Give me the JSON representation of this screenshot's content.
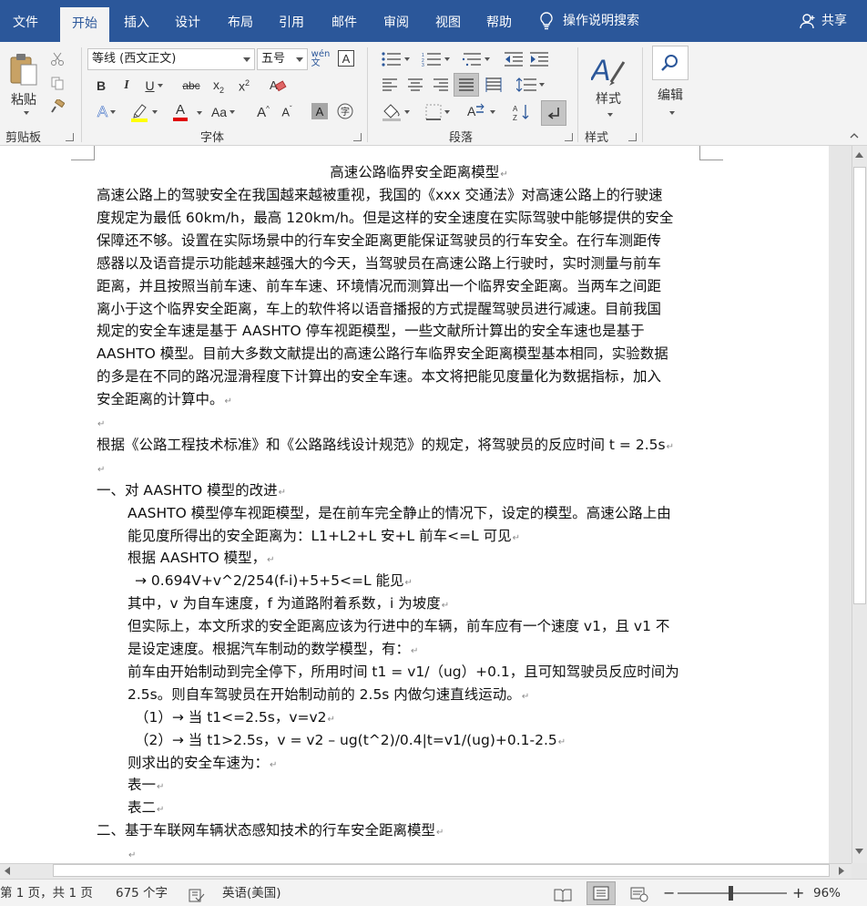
{
  "tabs": [
    "文件",
    "开始",
    "插入",
    "设计",
    "布局",
    "引用",
    "邮件",
    "审阅",
    "视图",
    "帮助"
  ],
  "tell_me": "操作说明搜索",
  "share": "共享",
  "clipboard": {
    "paste": "粘贴",
    "label": "剪贴板"
  },
  "font": {
    "name": "等线 (西文正文)",
    "size": "五号",
    "label": "字体"
  },
  "paragraph": {
    "label": "段落"
  },
  "styles": {
    "button": "样式",
    "label": "样式"
  },
  "editing": {
    "button": "编辑"
  },
  "document": {
    "title": "高速公路临界安全距离模型",
    "lines": [
      {
        "text": "高速公路上的驾驶安全在我国越来越被重视，我国的《xxx 交通法》对高速公路上的行驶速",
        "indent": 0,
        "mark": false
      },
      {
        "text": "度规定为最低 60km/h，最高 120km/h。但是这样的安全速度在实际驾驶中能够提供的安全",
        "indent": 0,
        "mark": false
      },
      {
        "text": "保障还不够。设置在实际场景中的行车安全距离更能保证驾驶员的行车安全。在行车测距传",
        "indent": 0,
        "mark": false
      },
      {
        "text": "感器以及语音提示功能越来越强大的今天，当驾驶员在高速公路上行驶时，实时测量与前车",
        "indent": 0,
        "mark": false
      },
      {
        "text": "距离，并且按照当前车速、前车车速、环境情况而测算出一个临界安全距离。当两车之间距",
        "indent": 0,
        "mark": false
      },
      {
        "text": "离小于这个临界安全距离，车上的软件将以语音播报的方式提醒驾驶员进行减速。目前我国",
        "indent": 0,
        "mark": false
      },
      {
        "text": "规定的安全车速是基于 AASHTO 停车视距模型，一些文献所计算出的安全车速也是基于",
        "indent": 0,
        "mark": false
      },
      {
        "text": "AASHTO 模型。目前大多数文献提出的高速公路行车临界安全距离模型基本相同，实验数据",
        "indent": 0,
        "mark": false
      },
      {
        "text": "的多是在不同的路况湿滑程度下计算出的安全车速。本文将把能见度量化为数据指标，加入",
        "indent": 0,
        "mark": false
      },
      {
        "text": "安全距离的计算中。",
        "indent": 0,
        "mark": true
      },
      {
        "text": "",
        "indent": 0,
        "mark": true
      },
      {
        "text": "根据《公路工程技术标准》和《公路路线设计规范》的规定，将驾驶员的反应时间 t = 2.5s",
        "indent": 0,
        "mark": true
      },
      {
        "text": "",
        "indent": 0,
        "mark": true
      },
      {
        "text": "一、对 AASHTO 模型的改进",
        "indent": 0,
        "mark": true
      },
      {
        "text": "AASHTO 模型停车视距模型，是在前车完全静止的情况下，设定的模型。高速公路上由",
        "indent": 1,
        "mark": false
      },
      {
        "text": "能见度所得出的安全距离为：L1+L2+L 安+L 前车<=L 可见",
        "indent": 1,
        "mark": true
      },
      {
        "text": "根据 AASHTO 模型，",
        "indent": 1,
        "mark": true
      },
      {
        "text": "→  0.694V+v^2/254(f-i)+5+5<=L 能见",
        "indent": 2,
        "mark": true
      },
      {
        "text": "其中，v 为自车速度，f 为道路附着系数，i 为坡度",
        "indent": 1,
        "mark": true
      },
      {
        "text": "但实际上，本文所求的安全距离应该为行进中的车辆，前车应有一个速度 v1，且 v1 不",
        "indent": 1,
        "mark": false
      },
      {
        "text": "是设定速度。根据汽车制动的数学模型，有：",
        "indent": 1,
        "mark": true
      },
      {
        "text": "前车由开始制动到完全停下，所用时间 t1 = v1/（ug）+0.1，且可知驾驶员反应时间为",
        "indent": 1,
        "mark": false
      },
      {
        "text": "2.5s。则自车驾驶员在开始制动前的 2.5s 内做匀速直线运动。",
        "indent": 1,
        "mark": true
      },
      {
        "text": "（1）→ 当 t1<=2.5s，v=v2",
        "indent": 2,
        "mark": true
      },
      {
        "text": "（2）→ 当 t1>2.5s，v = v2 – ug(t^2)/0.4|t=v1/(ug)+0.1-2.5",
        "indent": 2,
        "mark": true
      },
      {
        "text": "则求出的安全车速为：",
        "indent": 1,
        "mark": true
      },
      {
        "text": "表一",
        "indent": 1,
        "mark": true
      },
      {
        "text": "表二",
        "indent": 1,
        "mark": true
      },
      {
        "text": "二、基于车联网车辆状态感知技术的行车安全距离模型",
        "indent": 0,
        "mark": true
      },
      {
        "text": "",
        "indent": 1,
        "mark": true
      }
    ]
  },
  "status": {
    "page": "第 1 页，共 1 页",
    "words": "675 个字",
    "language": "英语(美国)",
    "zoom": "96%",
    "minus": "−",
    "plus": "+"
  }
}
